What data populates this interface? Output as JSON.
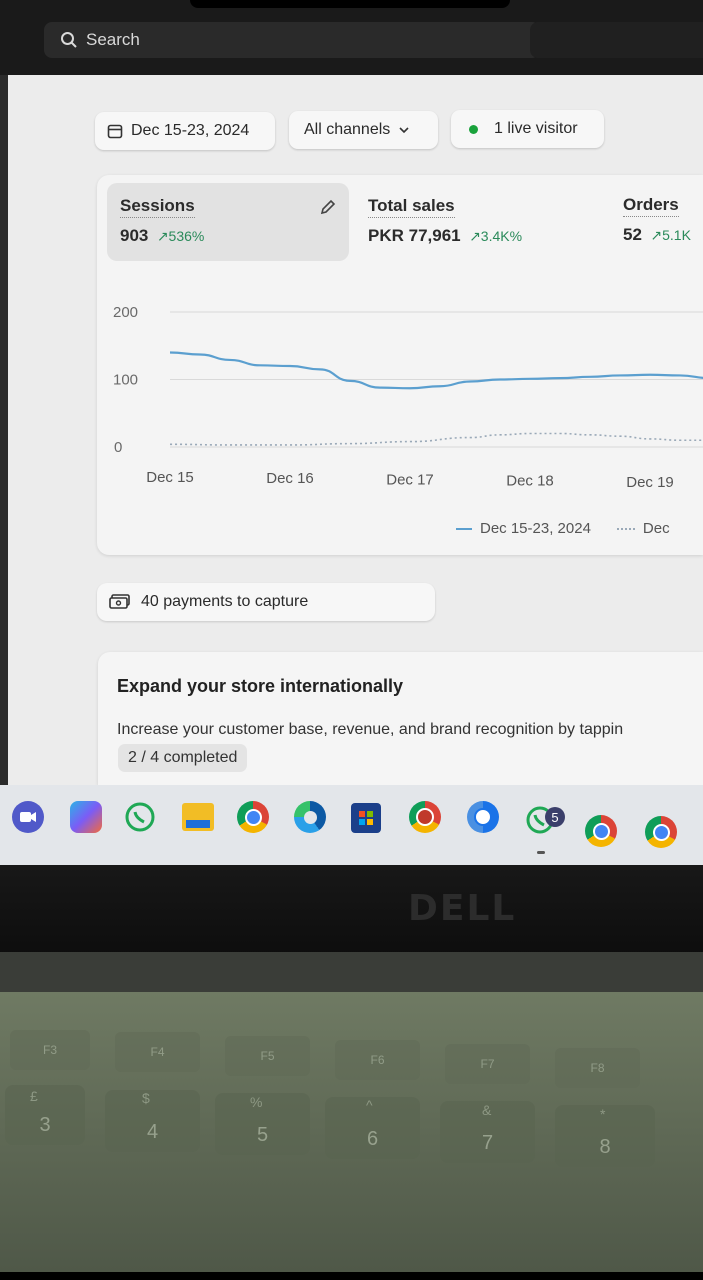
{
  "search": {
    "placeholder": "Search"
  },
  "filters": {
    "date_range": "Dec 15-23, 2024",
    "channels": "All channels",
    "live_visitors": "1 live visitor"
  },
  "metrics": [
    {
      "label": "Sessions",
      "value": "903",
      "delta": "↗536%"
    },
    {
      "label": "Total sales",
      "value": "PKR 77,961",
      "delta": "↗3.4K%"
    },
    {
      "label": "Orders",
      "value": "52",
      "delta": "↗5.1K"
    }
  ],
  "chart_data": {
    "type": "line",
    "categories": [
      "Dec 15",
      "Dec 16",
      "Dec 17",
      "Dec 18",
      "Dec 19"
    ],
    "y_ticks": [
      "200",
      "100",
      "0"
    ],
    "ylim": [
      0,
      200
    ],
    "grid": true,
    "series": [
      {
        "name": "Dec 15-23, 2024",
        "style": "solid",
        "color": "#5b9fcf",
        "x": [
          0,
          0.25,
          0.5,
          0.75,
          1,
          1.25,
          1.5,
          1.75,
          2,
          2.25,
          2.5,
          2.75,
          3,
          3.25,
          3.5,
          3.75,
          4,
          4.25,
          4.5
        ],
        "values": [
          140,
          137,
          129,
          121,
          120,
          115,
          98,
          88,
          87,
          90,
          97,
          100,
          101,
          102,
          104,
          106,
          107,
          106,
          102
        ]
      },
      {
        "name": "Dec",
        "style": "dotted",
        "color": "#9aa9b8",
        "x": [
          0,
          0.5,
          1,
          1.5,
          2,
          2.5,
          2.75,
          3,
          3.25,
          3.5,
          3.75,
          4,
          4.25,
          4.5
        ],
        "values": [
          4,
          3,
          3,
          5,
          8,
          14,
          18,
          20,
          20,
          18,
          16,
          12,
          10,
          10
        ]
      }
    ],
    "legend_position": "bottom"
  },
  "legend": {
    "current": "Dec 15-23, 2024",
    "previous": "Dec"
  },
  "payments": {
    "text": "40 payments to capture"
  },
  "expand_card": {
    "title": "Expand your store internationally",
    "description": "Increase your customer base, revenue, and brand recognition by tappin",
    "progress": "2 / 4 completed"
  },
  "taskbar": {
    "icons": [
      "teams-icon",
      "copilot-icon",
      "whatsapp-icon",
      "file-explorer-icon",
      "chrome-icon",
      "edge-icon",
      "microsoft-store-icon",
      "chrome-profile-icon",
      "chrome-profile-icon",
      "whatsapp-icon",
      "chrome-icon",
      "chrome-icon"
    ],
    "notification_count": "5"
  },
  "laptop": {
    "brand": "DELL"
  },
  "keyboard": {
    "fkeys": [
      "F3",
      "F4",
      "F5",
      "F6",
      "F7",
      "F8"
    ],
    "number_keys": [
      "3",
      "4",
      "5",
      "6",
      "7",
      "8"
    ],
    "symbol_keys": [
      "£",
      "$",
      "%",
      "^",
      "&",
      "*"
    ]
  },
  "colors": {
    "accent_line": "#5b9fcf",
    "positive_delta": "#2a8a5a",
    "live_dot": "#19a23b"
  }
}
